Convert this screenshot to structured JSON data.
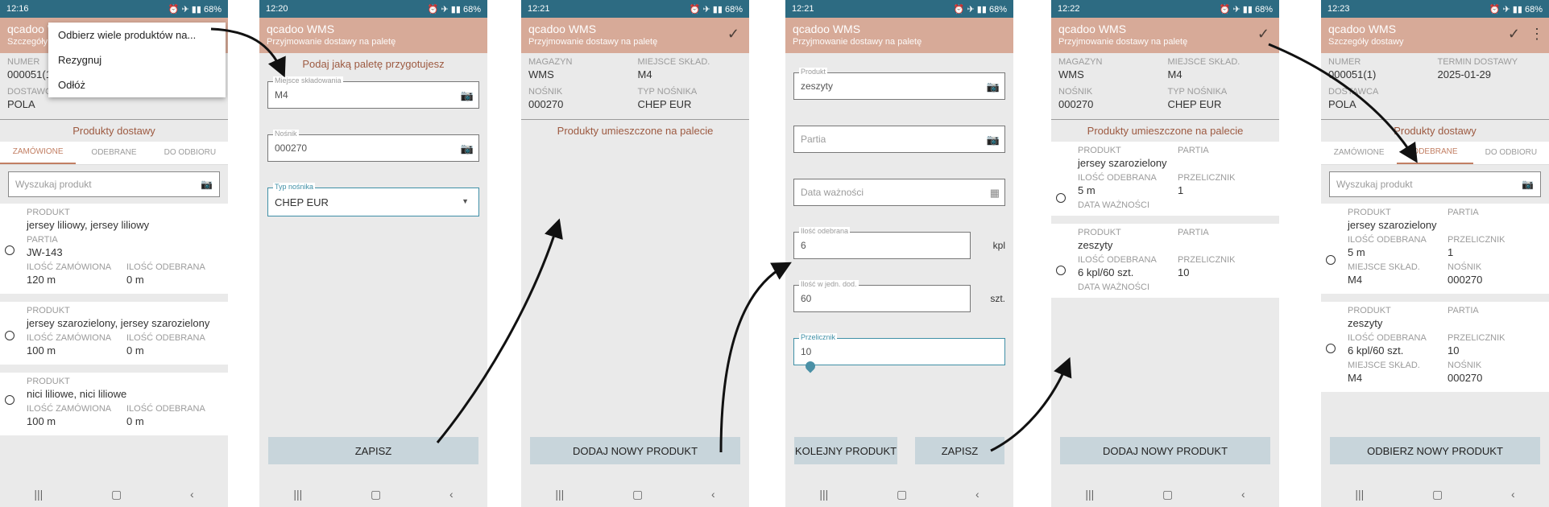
{
  "screens": [
    {
      "time": "12:16",
      "battery": "68%",
      "title": "qcadoo WMS",
      "subtitle": "Szczegóły dostawy",
      "menu": [
        "Odbierz wiele produktów na...",
        "Rezygnuj",
        "Odłóż"
      ],
      "info": {
        "numer_label": "NUMER",
        "numer": "000051(1)",
        "dostawca_label": "DOSTAWCA",
        "dostawca": "POLA"
      },
      "section": "Produkty dostawy",
      "tabs": [
        "ZAMÓWIONE",
        "ODEBRANE",
        "DO ODBIORU"
      ],
      "search_placeholder": "Wyszukaj produkt",
      "cards": [
        {
          "produkt_label": "PRODUKT",
          "produkt": "jersey liliowy, jersey liliowy",
          "partia_label": "PARTIA",
          "partia": "JW-143",
          "zam_label": "ILOŚĆ ZAMÓWIONA",
          "zam": "120 m",
          "odeb_label": "ILOŚĆ ODEBRANA",
          "odeb": "0 m"
        },
        {
          "produkt_label": "PRODUKT",
          "produkt": "jersey szarozielony, jersey szarozielony",
          "zam_label": "ILOŚĆ ZAMÓWIONA",
          "zam": "100 m",
          "odeb_label": "ILOŚĆ ODEBRANA",
          "odeb": "0 m"
        },
        {
          "produkt_label": "PRODUKT",
          "produkt": "nici liliowe, nici liliowe",
          "zam_label": "ILOŚĆ ZAMÓWIONA",
          "zam": "100 m",
          "odeb_label": "ILOŚĆ ODEBRANA",
          "odeb": "0 m"
        }
      ]
    },
    {
      "time": "12:20",
      "battery": "68%",
      "title": "qcadoo WMS",
      "subtitle": "Przyjmowanie dostawy na paletę",
      "heading": "Podaj jaką paletę przygotujesz",
      "fields": [
        {
          "label": "Miejsce składowania",
          "value": "M4"
        },
        {
          "label": "Nośnik",
          "value": "000270"
        },
        {
          "label": "Typ nośnika",
          "value": "CHEP EUR"
        }
      ],
      "button": "ZAPISZ"
    },
    {
      "time": "12:21",
      "battery": "68%",
      "title": "qcadoo WMS",
      "subtitle": "Przyjmowanie dostawy na paletę",
      "info": {
        "magazyn_label": "MAGAZYN",
        "magazyn": "WMS",
        "miejsce_label": "MIEJSCE SKŁAD.",
        "miejsce": "M4",
        "nosnik_label": "NOŚNIK",
        "nosnik": "000270",
        "typ_label": "TYP NOŚNIKA",
        "typ": "CHEP EUR"
      },
      "section": "Produkty umieszczone na palecie",
      "button": "DODAJ NOWY PRODUKT"
    },
    {
      "time": "12:21",
      "battery": "68%",
      "title": "qcadoo WMS",
      "subtitle": "Przyjmowanie dostawy na paletę",
      "fields": [
        {
          "label": "Produkt",
          "value": "zeszyty"
        },
        {
          "label": "",
          "value": "Partia"
        },
        {
          "label": "",
          "value": "Data ważności"
        },
        {
          "label": "Ilość odebrana",
          "value": "6",
          "unit": "kpl"
        },
        {
          "label": "Ilość w jedn. dod.",
          "value": "60",
          "unit": "szt."
        },
        {
          "label": "Przelicznik",
          "value": "10"
        }
      ],
      "button_left": "KOLEJNY PRODUKT",
      "button_right": "ZAPISZ"
    },
    {
      "time": "12:22",
      "battery": "68%",
      "title": "qcadoo WMS",
      "subtitle": "Przyjmowanie dostawy na paletę",
      "info": {
        "magazyn_label": "MAGAZYN",
        "magazyn": "WMS",
        "miejsce_label": "MIEJSCE SKŁAD.",
        "miejsce": "M4",
        "nosnik_label": "NOŚNIK",
        "nosnik": "000270",
        "typ_label": "TYP NOŚNIKA",
        "typ": "CHEP EUR"
      },
      "section": "Produkty umieszczone na palecie",
      "cards": [
        {
          "produkt_label": "PRODUKT",
          "produkt": "jersey szarozielony",
          "partia_label": "PARTIA",
          "odeb_label": "ILOŚĆ ODEBRANA",
          "odeb": "5 m",
          "przel_label": "PRZELICZNIK",
          "przel": "1",
          "data_label": "DATA WAŻNOŚCI"
        },
        {
          "produkt_label": "PRODUKT",
          "produkt": "zeszyty",
          "partia_label": "PARTIA",
          "odeb_label": "ILOŚĆ ODEBRANA",
          "odeb": "6 kpl/60 szt.",
          "przel_label": "PRZELICZNIK",
          "przel": "10",
          "data_label": "DATA WAŻNOŚCI"
        }
      ],
      "button": "DODAJ NOWY PRODUKT"
    },
    {
      "time": "12:23",
      "battery": "68%",
      "title": "qcadoo WMS",
      "subtitle": "Szczegóły dostawy",
      "info": {
        "numer_label": "NUMER",
        "numer": "000051(1)",
        "termin_label": "TERMIN DOSTAWY",
        "termin": "2025-01-29",
        "dostawca_label": "DOSTAWCA",
        "dostawca": "POLA"
      },
      "section": "Produkty dostawy",
      "tabs": [
        "ZAMÓWIONE",
        "ODEBRANE",
        "DO ODBIORU"
      ],
      "search_placeholder": "Wyszukaj produkt",
      "cards": [
        {
          "produkt_label": "PRODUKT",
          "produkt": "jersey szarozielony",
          "partia_label": "PARTIA",
          "odeb_label": "ILOŚĆ ODEBRANA",
          "odeb": "5 m",
          "przel_label": "PRZELICZNIK",
          "przel": "1",
          "miejsce_label": "MIEJSCE SKŁAD.",
          "miejsce": "M4",
          "nosnik_label": "NOŚNIK",
          "nosnik": "000270"
        },
        {
          "produkt_label": "PRODUKT",
          "produkt": "zeszyty",
          "partia_label": "PARTIA",
          "odeb_label": "ILOŚĆ ODEBRANA",
          "odeb": "6 kpl/60 szt.",
          "przel_label": "PRZELICZNIK",
          "przel": "10",
          "miejsce_label": "MIEJSCE SKŁAD.",
          "miejsce": "M4",
          "nosnik_label": "NOŚNIK",
          "nosnik": "000270"
        }
      ],
      "button": "ODBIERZ NOWY PRODUKT"
    }
  ]
}
